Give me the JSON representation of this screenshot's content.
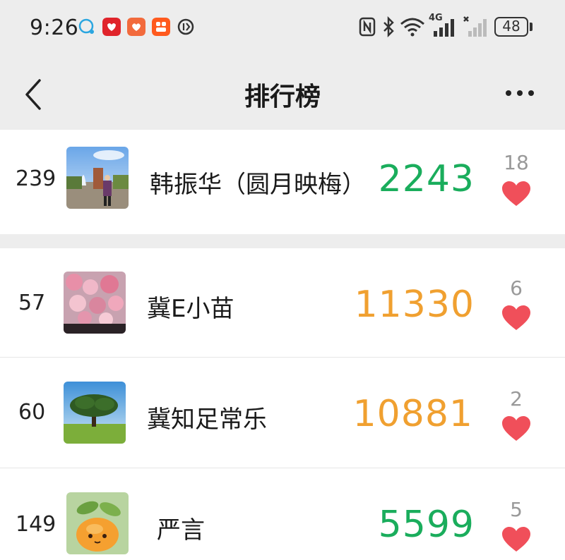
{
  "status_bar": {
    "time": "9:26",
    "battery": "48",
    "network": "4G"
  },
  "header": {
    "title": "排行榜"
  },
  "my_entry": {
    "rank": "239",
    "name": "韩振华（圆月映梅）",
    "steps": "2243",
    "likes": "18",
    "steps_color": "#1aad5c"
  },
  "ranking": [
    {
      "rank": "57",
      "name": "冀E小苗",
      "steps": "11330",
      "likes": "6",
      "steps_color": "#f0a030"
    },
    {
      "rank": "60",
      "name": "冀知足常乐",
      "steps": "10881",
      "likes": "2",
      "steps_color": "#f0a030"
    },
    {
      "rank": "149",
      "name": "严言",
      "steps": "5599",
      "likes": "5",
      "steps_color": "#1aad5c"
    }
  ],
  "colors": {
    "heart": "#f04f5a",
    "green": "#1aad5c",
    "orange": "#f0a030"
  }
}
